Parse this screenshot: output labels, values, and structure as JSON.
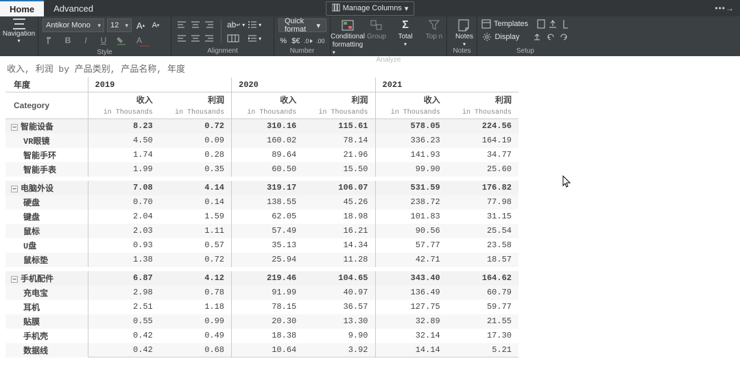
{
  "tabs": {
    "home": "Home",
    "advanced": "Advanced"
  },
  "manage_columns": "Manage Columns",
  "ribbon": {
    "navigation": "Navigation",
    "style_group": "Style",
    "alignment_group": "Alignment",
    "number_group": "Number",
    "analyze_group": "Analyze",
    "notes_group": "Notes",
    "setup_group": "Setup",
    "font_name": "Antikor Mono",
    "font_size": "12",
    "quick_format": "Quick format",
    "conditional": "Conditional",
    "formatting": "formatting",
    "group": "Group",
    "total": "Total",
    "topn": "Top n",
    "notes": "Notes",
    "templates": "Templates",
    "display": "Display"
  },
  "title": "收入, 利润 by 产品类别, 产品名称, 年度",
  "headers": {
    "year": "年度",
    "category": "Category",
    "years": [
      "2019",
      "2020",
      "2021"
    ],
    "metric_rev": "收入",
    "metric_profit": "利润",
    "sub": "in Thousands"
  },
  "chart_data": {
    "type": "table",
    "columns": [
      "产品类别",
      "产品名称",
      "年度",
      "收入 (Thousands)",
      "利润 (Thousands)"
    ],
    "category_totals": [
      {
        "category": "智能设备",
        "2019": {
          "rev": 8.23,
          "profit": 0.72
        },
        "2020": {
          "rev": 310.16,
          "profit": 115.61
        },
        "2021": {
          "rev": 578.05,
          "profit": 224.56
        }
      },
      {
        "category": "电脑外设",
        "2019": {
          "rev": 7.08,
          "profit": 4.14
        },
        "2020": {
          "rev": 319.17,
          "profit": 106.07
        },
        "2021": {
          "rev": 531.59,
          "profit": 176.82
        }
      },
      {
        "category": "手机配件",
        "2019": {
          "rev": 6.87,
          "profit": 4.12
        },
        "2020": {
          "rev": 219.46,
          "profit": 104.65
        },
        "2021": {
          "rev": 343.4,
          "profit": 164.62
        }
      }
    ],
    "rows": [
      {
        "category": "智能设备",
        "product": "VR眼镜",
        "2019": {
          "rev": 4.5,
          "profit": 0.09
        },
        "2020": {
          "rev": 160.02,
          "profit": 78.14
        },
        "2021": {
          "rev": 336.23,
          "profit": 164.19
        }
      },
      {
        "category": "智能设备",
        "product": "智能手环",
        "2019": {
          "rev": 1.74,
          "profit": 0.28
        },
        "2020": {
          "rev": 89.64,
          "profit": 21.96
        },
        "2021": {
          "rev": 141.93,
          "profit": 34.77
        }
      },
      {
        "category": "智能设备",
        "product": "智能手表",
        "2019": {
          "rev": 1.99,
          "profit": 0.35
        },
        "2020": {
          "rev": 60.5,
          "profit": 15.5
        },
        "2021": {
          "rev": 99.9,
          "profit": 25.6
        }
      },
      {
        "category": "电脑外设",
        "product": "硬盘",
        "2019": {
          "rev": 0.7,
          "profit": 0.14
        },
        "2020": {
          "rev": 138.55,
          "profit": 45.26
        },
        "2021": {
          "rev": 238.72,
          "profit": 77.98
        }
      },
      {
        "category": "电脑外设",
        "product": "键盘",
        "2019": {
          "rev": 2.04,
          "profit": 1.59
        },
        "2020": {
          "rev": 62.05,
          "profit": 18.98
        },
        "2021": {
          "rev": 101.83,
          "profit": 31.15
        }
      },
      {
        "category": "电脑外设",
        "product": "鼠标",
        "2019": {
          "rev": 2.03,
          "profit": 1.11
        },
        "2020": {
          "rev": 57.49,
          "profit": 16.21
        },
        "2021": {
          "rev": 90.56,
          "profit": 25.54
        }
      },
      {
        "category": "电脑外设",
        "product": "U盘",
        "2019": {
          "rev": 0.93,
          "profit": 0.57
        },
        "2020": {
          "rev": 35.13,
          "profit": 14.34
        },
        "2021": {
          "rev": 57.77,
          "profit": 23.58
        }
      },
      {
        "category": "电脑外设",
        "product": "鼠标垫",
        "2019": {
          "rev": 1.38,
          "profit": 0.72
        },
        "2020": {
          "rev": 25.94,
          "profit": 11.28
        },
        "2021": {
          "rev": 42.71,
          "profit": 18.57
        }
      },
      {
        "category": "手机配件",
        "product": "充电宝",
        "2019": {
          "rev": 2.98,
          "profit": 0.78
        },
        "2020": {
          "rev": 91.99,
          "profit": 40.97
        },
        "2021": {
          "rev": 136.49,
          "profit": 60.79
        }
      },
      {
        "category": "手机配件",
        "product": "耳机",
        "2019": {
          "rev": 2.51,
          "profit": 1.18
        },
        "2020": {
          "rev": 78.15,
          "profit": 36.57
        },
        "2021": {
          "rev": 127.75,
          "profit": 59.77
        }
      },
      {
        "category": "手机配件",
        "product": "贴膜",
        "2019": {
          "rev": 0.55,
          "profit": 0.99
        },
        "2020": {
          "rev": 20.3,
          "profit": 13.3
        },
        "2021": {
          "rev": 32.89,
          "profit": 21.55
        }
      },
      {
        "category": "手机配件",
        "product": "手机壳",
        "2019": {
          "rev": 0.42,
          "profit": 0.49
        },
        "2020": {
          "rev": 18.38,
          "profit": 9.9
        },
        "2021": {
          "rev": 32.14,
          "profit": 17.3
        }
      },
      {
        "category": "手机配件",
        "product": "数据线",
        "2019": {
          "rev": 0.42,
          "profit": 0.68
        },
        "2020": {
          "rev": 10.64,
          "profit": 3.92
        },
        "2021": {
          "rev": 14.14,
          "profit": 5.21
        }
      }
    ]
  },
  "table": {
    "groups": [
      {
        "label": "智能设备",
        "totals": [
          "8.23",
          "0.72",
          "310.16",
          "115.61",
          "578.05",
          "224.56"
        ],
        "rows": [
          {
            "label": "VR眼镜",
            "vals": [
              "4.50",
              "0.09",
              "160.02",
              "78.14",
              "336.23",
              "164.19"
            ]
          },
          {
            "label": "智能手环",
            "vals": [
              "1.74",
              "0.28",
              "89.64",
              "21.96",
              "141.93",
              "34.77"
            ]
          },
          {
            "label": "智能手表",
            "vals": [
              "1.99",
              "0.35",
              "60.50",
              "15.50",
              "99.90",
              "25.60"
            ]
          }
        ]
      },
      {
        "label": "电脑外设",
        "totals": [
          "7.08",
          "4.14",
          "319.17",
          "106.07",
          "531.59",
          "176.82"
        ],
        "rows": [
          {
            "label": "硬盘",
            "vals": [
              "0.70",
              "0.14",
              "138.55",
              "45.26",
              "238.72",
              "77.98"
            ]
          },
          {
            "label": "键盘",
            "vals": [
              "2.04",
              "1.59",
              "62.05",
              "18.98",
              "101.83",
              "31.15"
            ]
          },
          {
            "label": "鼠标",
            "vals": [
              "2.03",
              "1.11",
              "57.49",
              "16.21",
              "90.56",
              "25.54"
            ]
          },
          {
            "label": "U盘",
            "vals": [
              "0.93",
              "0.57",
              "35.13",
              "14.34",
              "57.77",
              "23.58"
            ]
          },
          {
            "label": "鼠标垫",
            "vals": [
              "1.38",
              "0.72",
              "25.94",
              "11.28",
              "42.71",
              "18.57"
            ]
          }
        ]
      },
      {
        "label": "手机配件",
        "totals": [
          "6.87",
          "4.12",
          "219.46",
          "104.65",
          "343.40",
          "164.62"
        ],
        "rows": [
          {
            "label": "充电宝",
            "vals": [
              "2.98",
              "0.78",
              "91.99",
              "40.97",
              "136.49",
              "60.79"
            ]
          },
          {
            "label": "耳机",
            "vals": [
              "2.51",
              "1.18",
              "78.15",
              "36.57",
              "127.75",
              "59.77"
            ]
          },
          {
            "label": "贴膜",
            "vals": [
              "0.55",
              "0.99",
              "20.30",
              "13.30",
              "32.89",
              "21.55"
            ]
          },
          {
            "label": "手机壳",
            "vals": [
              "0.42",
              "0.49",
              "18.38",
              "9.90",
              "32.14",
              "17.30"
            ]
          },
          {
            "label": "数据线",
            "vals": [
              "0.42",
              "0.68",
              "10.64",
              "3.92",
              "14.14",
              "5.21"
            ]
          }
        ]
      }
    ]
  }
}
